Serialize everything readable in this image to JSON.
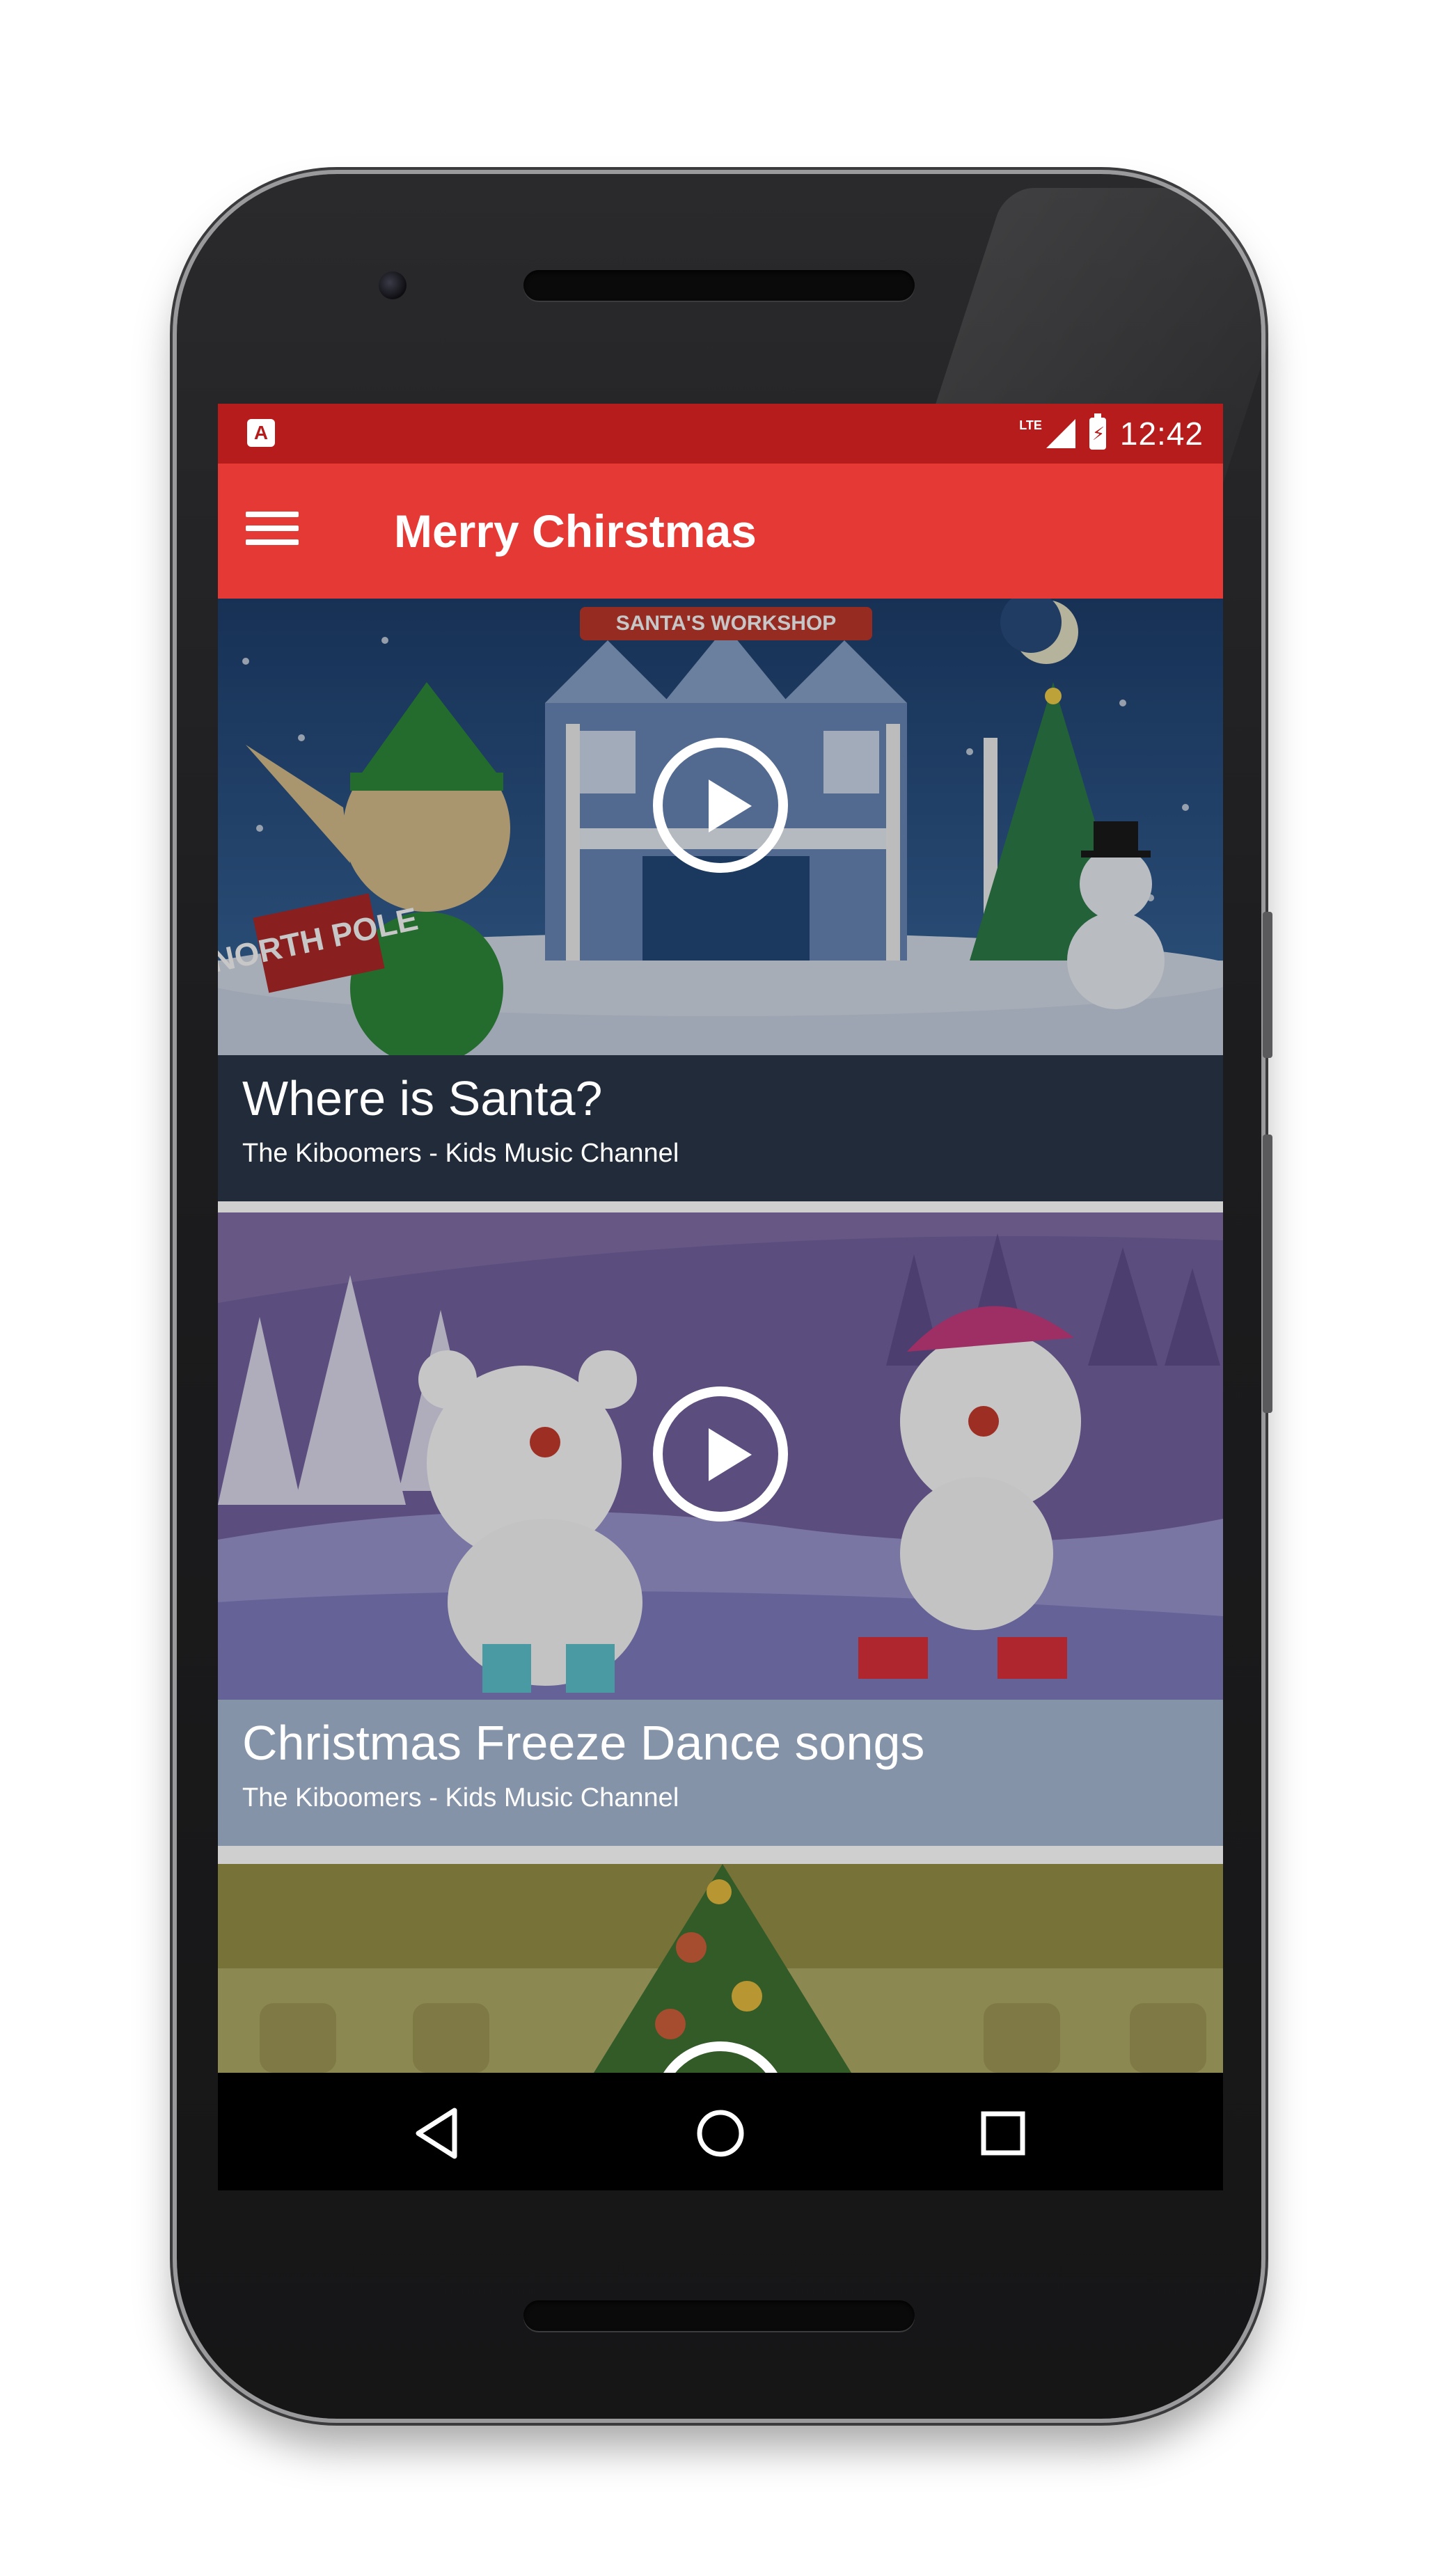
{
  "status_bar": {
    "notification_icon": "A",
    "network": "LTE",
    "time": "12:42"
  },
  "app_bar": {
    "menu_icon": "hamburger-menu-icon",
    "title": "Merry Chirstmas"
  },
  "colors": {
    "status_bar": "#b71c1c",
    "app_bar": "#e53935",
    "card1_caption": "#212b3a",
    "card2_caption": "#8593a8"
  },
  "videos": [
    {
      "title": "Where is Santa?",
      "channel": "The Kiboomers - Kids Music Channel"
    },
    {
      "title": "Christmas Freeze Dance songs",
      "channel": "The Kiboomers - Kids Music Channel"
    },
    {
      "title": "",
      "channel": ""
    }
  ],
  "thumbnail_text": {
    "workshop_sign": "SANTA'S WORKSHOP",
    "pole_sign": "NORTH POLE"
  },
  "nav": {
    "back": "back-triangle-icon",
    "home": "home-circle-icon",
    "recents": "recents-square-icon"
  }
}
